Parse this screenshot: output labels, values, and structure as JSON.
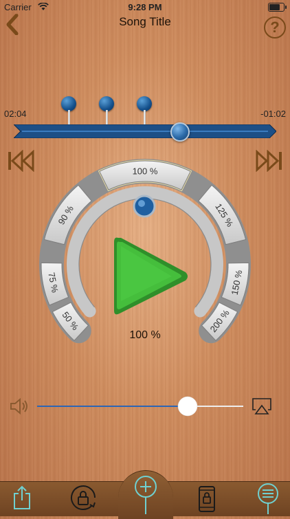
{
  "status_bar": {
    "carrier": "Carrier",
    "time": "9:28 PM",
    "battery_level": 0.9
  },
  "header": {
    "title": "Song Title",
    "back_icon": "chevron-left-icon",
    "help_icon": "question-mark-icon",
    "help_label": "?"
  },
  "timeline": {
    "elapsed": "02:04",
    "remaining": "-01:02",
    "position": 0.64,
    "markers": 3
  },
  "controls": {
    "rewind_icon": "skip-back-icon",
    "forward_icon": "skip-forward-icon",
    "play_icon": "play-icon"
  },
  "speed_dial": {
    "labels": [
      "50 %",
      "75 %",
      "90 %",
      "100 %",
      "125 %",
      "150 %",
      "200 %"
    ],
    "current": "100 %"
  },
  "volume": {
    "level": 0.73,
    "speaker_icon": "speaker-icon",
    "airplay_icon": "airplay-icon"
  },
  "toolbar": {
    "items": [
      "share-icon",
      "rotation-lock-icon",
      "add-marker-icon",
      "screen-lock-icon",
      "marker-list-icon"
    ]
  },
  "colors": {
    "accent_blue": "#1f5fa0",
    "play_green": "#3fb536",
    "wood": "#cf8d5f"
  }
}
